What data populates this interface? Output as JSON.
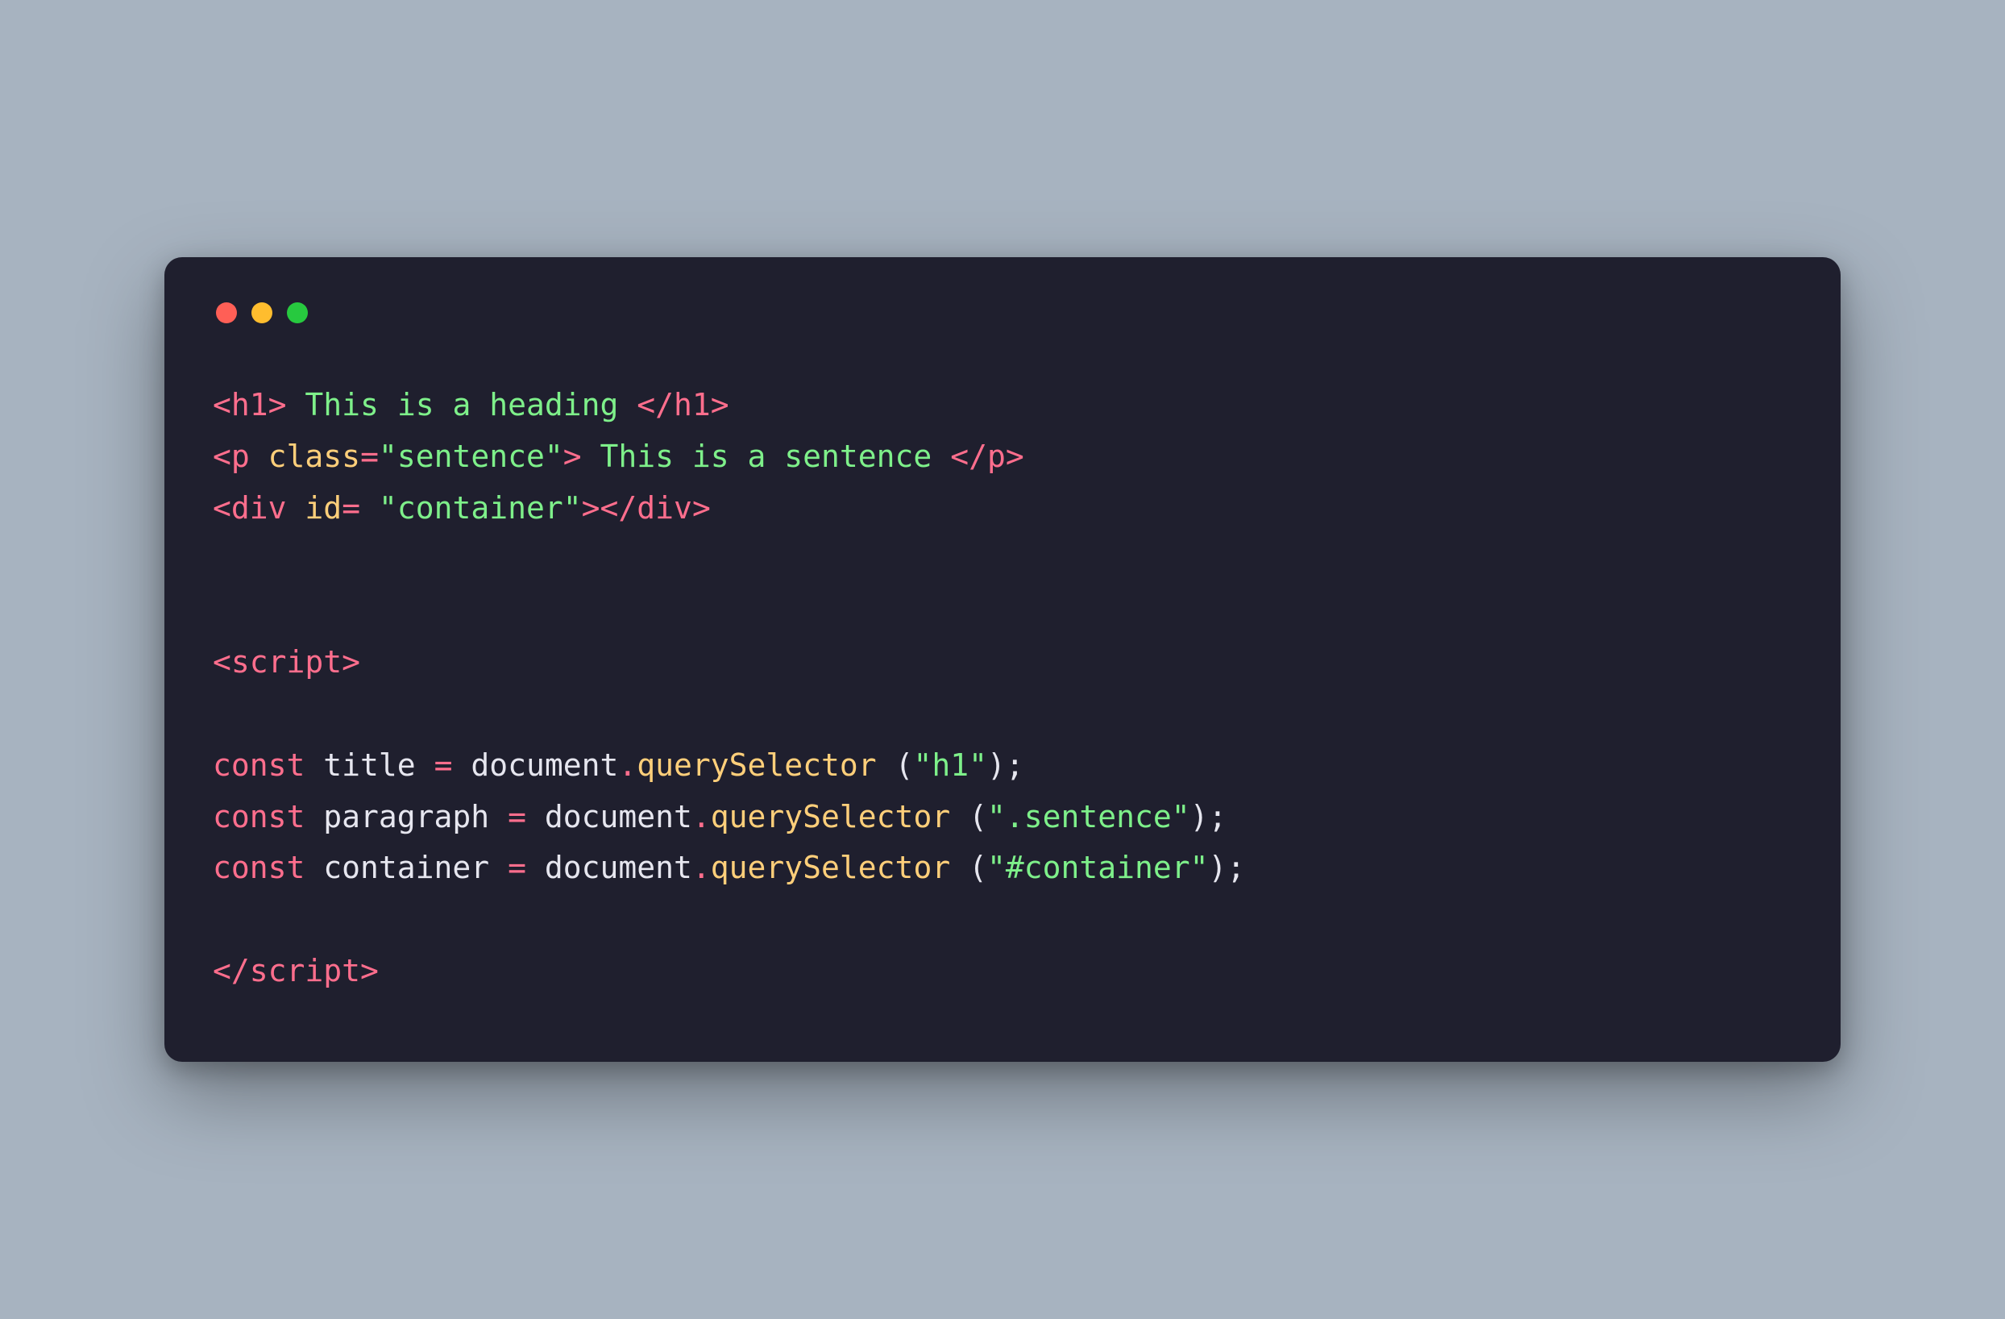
{
  "colors": {
    "bg": "#a7b3c0",
    "editor_bg": "#1f1f2e",
    "dot_red": "#ff5f56",
    "dot_yellow": "#ffbd2e",
    "dot_green": "#27c93f",
    "tag": "#ff6e8d",
    "attr": "#ffcf7a",
    "string": "#7ef08a",
    "keyword": "#ff6e8d",
    "method": "#ffcf7a",
    "default": "#e6e6ef"
  },
  "code": {
    "lines": [
      {
        "tokens": [
          {
            "t": "<",
            "c": "angle"
          },
          {
            "t": "h1",
            "c": "tag"
          },
          {
            "t": ">",
            "c": "angle"
          },
          {
            "t": " This is a heading ",
            "c": "text"
          },
          {
            "t": "</",
            "c": "angle"
          },
          {
            "t": "h1",
            "c": "tag"
          },
          {
            "t": ">",
            "c": "angle"
          }
        ]
      },
      {
        "tokens": [
          {
            "t": "<",
            "c": "angle"
          },
          {
            "t": "p",
            "c": "tag"
          },
          {
            "t": " ",
            "c": "ident"
          },
          {
            "t": "class",
            "c": "attr"
          },
          {
            "t": "=",
            "c": "eq"
          },
          {
            "t": "\"sentence\"",
            "c": "str"
          },
          {
            "t": ">",
            "c": "angle"
          },
          {
            "t": " This is a sentence ",
            "c": "text"
          },
          {
            "t": "</",
            "c": "angle"
          },
          {
            "t": "p",
            "c": "tag"
          },
          {
            "t": ">",
            "c": "angle"
          }
        ]
      },
      {
        "tokens": [
          {
            "t": "<",
            "c": "angle"
          },
          {
            "t": "div",
            "c": "tag"
          },
          {
            "t": " ",
            "c": "ident"
          },
          {
            "t": "id",
            "c": "attr"
          },
          {
            "t": "=",
            "c": "eq"
          },
          {
            "t": " ",
            "c": "ident"
          },
          {
            "t": "\"container\"",
            "c": "str"
          },
          {
            "t": ">",
            "c": "angle"
          },
          {
            "t": "</",
            "c": "angle"
          },
          {
            "t": "div",
            "c": "tag"
          },
          {
            "t": ">",
            "c": "angle"
          }
        ]
      },
      {
        "tokens": []
      },
      {
        "tokens": []
      },
      {
        "tokens": [
          {
            "t": "<",
            "c": "angle"
          },
          {
            "t": "script",
            "c": "tag"
          },
          {
            "t": ">",
            "c": "angle"
          }
        ]
      },
      {
        "tokens": []
      },
      {
        "tokens": [
          {
            "t": "const",
            "c": "kw"
          },
          {
            "t": " ",
            "c": "ident"
          },
          {
            "t": "title",
            "c": "ident"
          },
          {
            "t": " ",
            "c": "ident"
          },
          {
            "t": "=",
            "c": "eq"
          },
          {
            "t": " ",
            "c": "ident"
          },
          {
            "t": "document",
            "c": "prop"
          },
          {
            "t": ".",
            "c": "dot"
          },
          {
            "t": "querySelector",
            "c": "method"
          },
          {
            "t": " ",
            "c": "ident"
          },
          {
            "t": "(",
            "c": "punc"
          },
          {
            "t": "\"h1\"",
            "c": "str"
          },
          {
            "t": ")",
            "c": "punc"
          },
          {
            "t": ";",
            "c": "punc"
          }
        ]
      },
      {
        "tokens": [
          {
            "t": "const",
            "c": "kw"
          },
          {
            "t": " ",
            "c": "ident"
          },
          {
            "t": "paragraph",
            "c": "ident"
          },
          {
            "t": " ",
            "c": "ident"
          },
          {
            "t": "=",
            "c": "eq"
          },
          {
            "t": " ",
            "c": "ident"
          },
          {
            "t": "document",
            "c": "prop"
          },
          {
            "t": ".",
            "c": "dot"
          },
          {
            "t": "querySelector",
            "c": "method"
          },
          {
            "t": " ",
            "c": "ident"
          },
          {
            "t": "(",
            "c": "punc"
          },
          {
            "t": "\".sentence\"",
            "c": "str"
          },
          {
            "t": ")",
            "c": "punc"
          },
          {
            "t": ";",
            "c": "punc"
          }
        ]
      },
      {
        "tokens": [
          {
            "t": "const",
            "c": "kw"
          },
          {
            "t": " ",
            "c": "ident"
          },
          {
            "t": "container",
            "c": "ident"
          },
          {
            "t": " ",
            "c": "ident"
          },
          {
            "t": "=",
            "c": "eq"
          },
          {
            "t": " ",
            "c": "ident"
          },
          {
            "t": "document",
            "c": "prop"
          },
          {
            "t": ".",
            "c": "dot"
          },
          {
            "t": "querySelector",
            "c": "method"
          },
          {
            "t": " ",
            "c": "ident"
          },
          {
            "t": "(",
            "c": "punc"
          },
          {
            "t": "\"#container\"",
            "c": "str"
          },
          {
            "t": ")",
            "c": "punc"
          },
          {
            "t": ";",
            "c": "punc"
          }
        ]
      },
      {
        "tokens": []
      },
      {
        "tokens": [
          {
            "t": "</",
            "c": "angle"
          },
          {
            "t": "script",
            "c": "tag"
          },
          {
            "t": ">",
            "c": "angle"
          }
        ]
      }
    ]
  }
}
